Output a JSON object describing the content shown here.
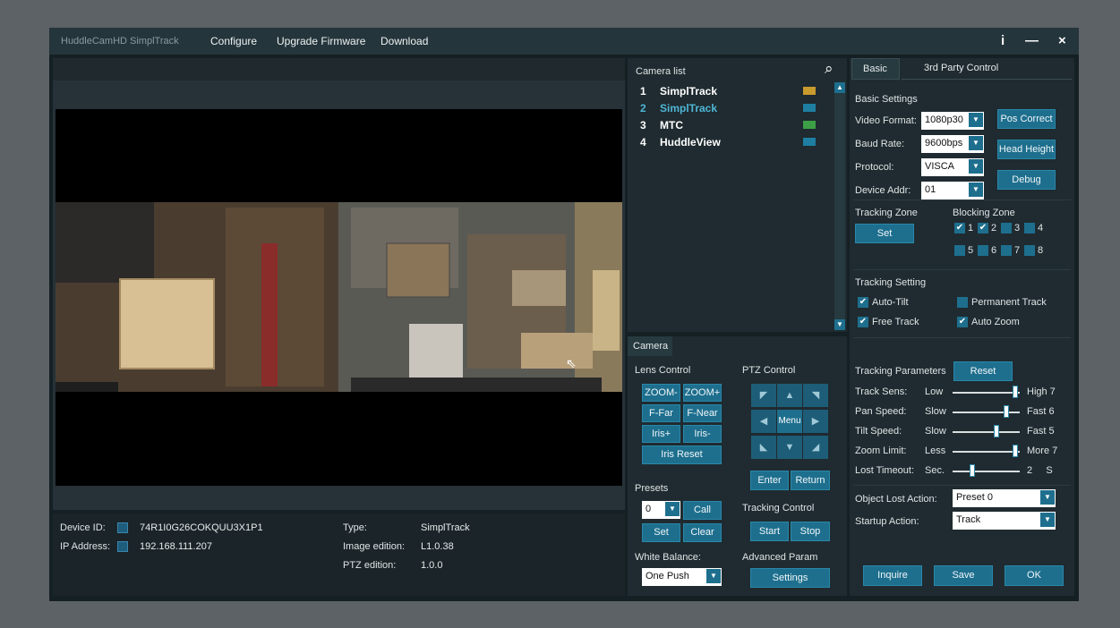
{
  "titlebar": {
    "app_name": "HuddleCamHD SimplTrack",
    "menu": [
      "Configure",
      "Upgrade Firmware",
      "Download"
    ],
    "info_btn": "i",
    "minimize_btn": "—",
    "close_btn": "×"
  },
  "info": {
    "device_id_label": "Device ID:",
    "device_id": "74R1I0G26COKQUU3X1P1",
    "ip_label": "IP Address:",
    "ip": "192.168.111.207",
    "type_label": "Type:",
    "type": "SimplTrack",
    "image_label": "Image edition:",
    "image": "L1.0.38",
    "ptz_label": "PTZ edition:",
    "ptz": "1.0.0"
  },
  "camera_list": {
    "title": "Camera list",
    "items": [
      {
        "num": "1",
        "name": "SimplTrack"
      },
      {
        "num": "2",
        "name": "SimplTrack"
      },
      {
        "num": "3",
        "name": "MTC"
      },
      {
        "num": "4",
        "name": "HuddleView"
      }
    ]
  },
  "camera": {
    "tab": "Camera",
    "lens_title": "Lens Control",
    "lens_buttons": [
      "ZOOM-",
      "ZOOM+",
      "F-Far",
      "F-Near",
      "Iris+",
      "Iris-"
    ],
    "iris_reset": "Iris Reset",
    "ptz_title": "PTZ Control",
    "menu_btn": "Menu",
    "enter_btn": "Enter",
    "return_btn": "Return",
    "presets_title": "Presets",
    "preset_value": "0",
    "call_btn": "Call",
    "set_btn": "Set",
    "clear_btn": "Clear",
    "tracking_title": "Tracking Control",
    "start_btn": "Start",
    "stop_btn": "Stop",
    "wb_title": "White Balance:",
    "wb_value": "One Push",
    "adv_title": "Advanced Param",
    "settings_btn": "Settings"
  },
  "right": {
    "tabs": [
      "Basic",
      "3rd Party Control"
    ],
    "basic_title": "Basic Settings",
    "video_format_label": "Video Format:",
    "video_format": "1080p30",
    "baud_label": "Baud Rate:",
    "baud": "9600bps",
    "protocol_label": "Protocol:",
    "protocol": "VISCA",
    "addr_label": "Device Addr:",
    "addr": "01",
    "pos_correct": "Pos Correct",
    "head_height": "Head Height",
    "debug": "Debug",
    "tracking_zone": "Tracking Zone",
    "set_btn": "Set",
    "blocking_zone": "Blocking Zone",
    "zones": [
      "1",
      "2",
      "3",
      "4",
      "5",
      "6",
      "7",
      "8"
    ],
    "tracking_setting": "Tracking Setting",
    "auto_tilt": "Auto-Tilt",
    "permanent_track": "Permanent Track",
    "free_track": "Free Track",
    "auto_zoom": "Auto Zoom",
    "params_title": "Tracking Parameters",
    "reset_btn": "Reset",
    "params": [
      {
        "label": "Track Sens:",
        "low": "Low",
        "high": "High 7"
      },
      {
        "label": "Pan Speed:",
        "low": "Slow",
        "high": "Fast  6"
      },
      {
        "label": "Tilt Speed:",
        "low": "Slow",
        "high": "Fast  5"
      },
      {
        "label": "Zoom Limit:",
        "low": "Less",
        "high": "More 7"
      },
      {
        "label": "Lost Timeout:",
        "low": "Sec.",
        "high": "2     S"
      }
    ],
    "object_lost_label": "Object Lost Action:",
    "object_lost_value": "Preset 0",
    "startup_label": "Startup Action:",
    "startup_value": "Track",
    "inquire_btn": "Inquire",
    "save_btn": "Save",
    "ok_btn": "OK"
  }
}
